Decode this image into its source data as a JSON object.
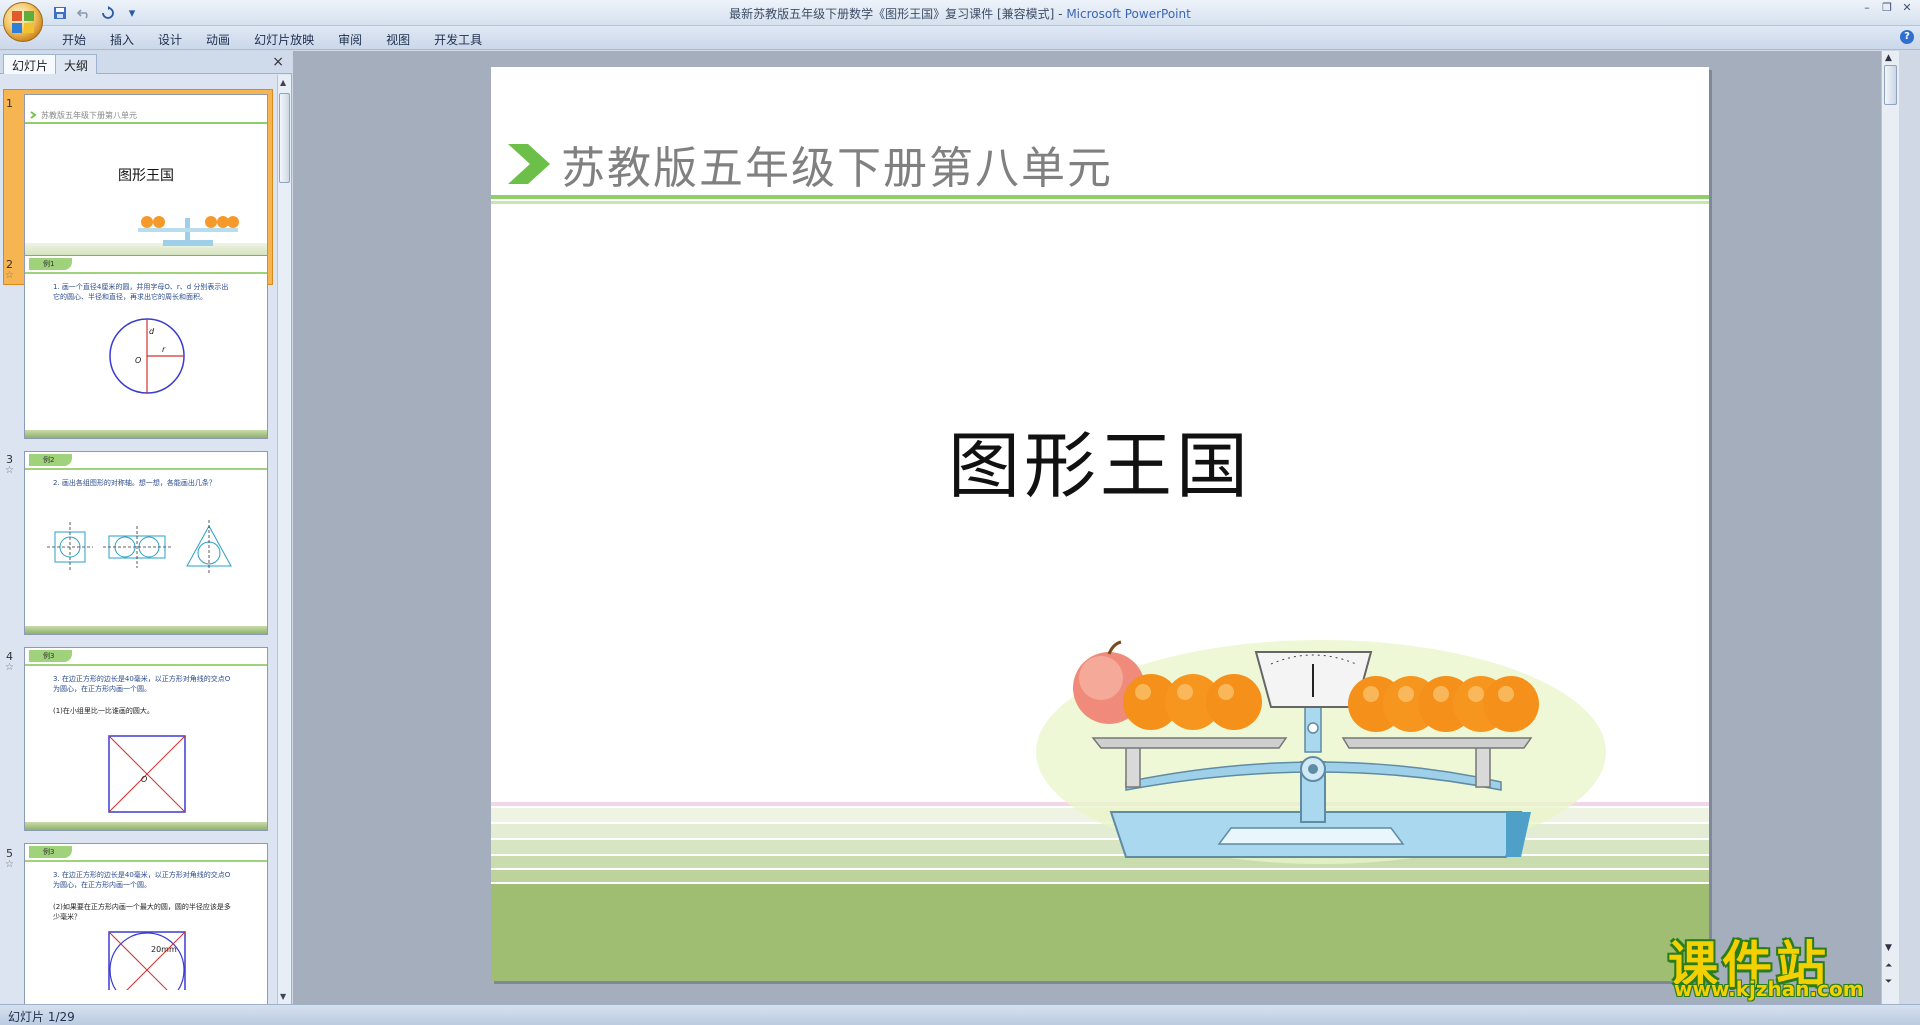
{
  "window": {
    "title": "最新苏教版五年级下册数学《图形王国》复习课件 [兼容模式] - ",
    "app_name": "Microsoft PowerPoint"
  },
  "qat": {
    "save": "save-icon",
    "undo": "undo-icon",
    "redo": "redo-icon",
    "more": "▾"
  },
  "ribbon": {
    "tabs": [
      "开始",
      "插入",
      "设计",
      "动画",
      "幻灯片放映",
      "审阅",
      "视图",
      "开发工具"
    ],
    "help": "?"
  },
  "panel": {
    "tab_slides": "幻灯片",
    "tab_outline": "大纲",
    "close": "×"
  },
  "thumbnails": [
    {
      "num": "1",
      "header": "苏教版五年级下册第八单元",
      "title": "图形王国"
    },
    {
      "num": "2",
      "tag": "例1",
      "text": "1. 画一个直径4厘米的圆，并用字母O、r、d 分别表示出它的圆心、半径和直径，再求出它的周长和面积。",
      "labels": [
        "d",
        "r",
        "O"
      ]
    },
    {
      "num": "3",
      "tag": "例2",
      "text": "2. 画出各组图形的对称轴。想一想，各能画出几条？"
    },
    {
      "num": "4",
      "tag": "例3",
      "text": "3. 在边正方形的边长是40毫米，以正方形对角线的交点O为圆心，在正方形内画一个圆。",
      "sub": "(1)在小组里比一比谁画的圆大。",
      "label": "O"
    },
    {
      "num": "5",
      "tag": "例3",
      "text": "3. 在边正方形的边长是40毫米，以正方形对角线的交点O为圆心，在正方形内画一个圆。",
      "sub": "(2)如果要在正方形内画一个最大的圆，圆的半径应该是多少毫米？",
      "label": "20mm"
    }
  ],
  "slide": {
    "header": "苏教版五年级下册第八单元",
    "title": "图形王国"
  },
  "status": {
    "text": "幻灯片 1/29"
  },
  "watermark": {
    "cn": "课件站",
    "url": "www.kjzhan.com"
  },
  "colors": {
    "accent_green": "#8fcf6a",
    "header_gray": "#808080",
    "orange": "#f58a14"
  }
}
